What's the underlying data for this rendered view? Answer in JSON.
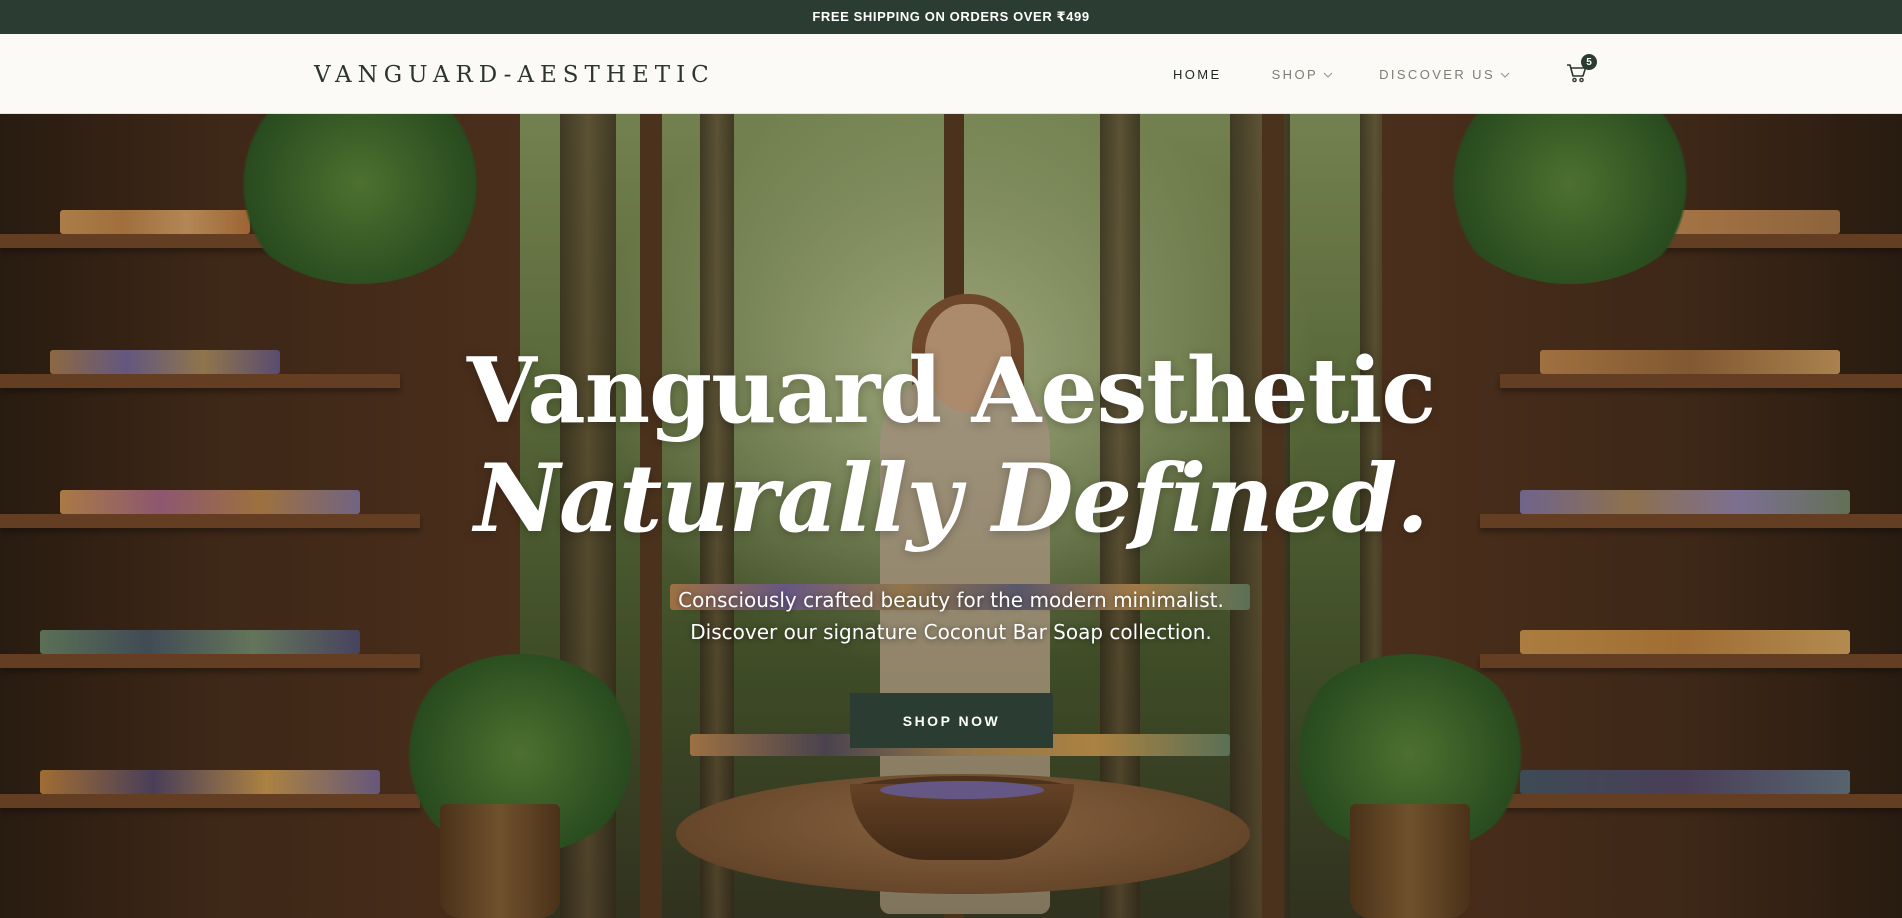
{
  "announcement": {
    "text": "FREE SHIPPING ON ORDERS OVER ₹499"
  },
  "header": {
    "logo": "VANGUARD-AESTHETIC",
    "nav": [
      {
        "label": "HOME",
        "active": true
      },
      {
        "label": "SHOP",
        "dropdown": true
      },
      {
        "label": "DISCOVER US",
        "dropdown": true
      }
    ],
    "cart": {
      "icon": "cart-icon",
      "count": "5"
    }
  },
  "hero": {
    "title_line1": "Vanguard Aesthetic",
    "title_line2": "Naturally Defined.",
    "subtitle_line1": "Consciously crafted beauty for the modern minimalist.",
    "subtitle_line2": "Discover our signature Coconut Bar Soap collection.",
    "cta": "SHOP NOW"
  },
  "colors": {
    "brand_dark_green": "#2b3d33",
    "header_bg": "#fbfaf6",
    "text_dark": "#2c3530",
    "nav_muted": "#7d7d78"
  }
}
